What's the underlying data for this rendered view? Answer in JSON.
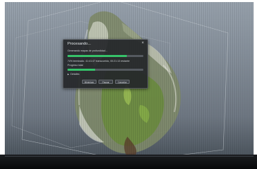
{
  "dialog": {
    "title": "Procesando...",
    "task_label": "Generando mapas de profundidad...",
    "task_progress": 0.78,
    "status_line": "74% terminado. 41:41:47 transcurrido, 00:21:13 restante",
    "total_label": "Progreso total",
    "total_progress": 0.36,
    "details_label": "Detalles",
    "buttons": {
      "minimize": "Minimizar",
      "pause": "Pausar",
      "cancel": "Cancelar"
    }
  },
  "colors": {
    "progress_fill": "#36c36a",
    "dialog_bg": "#242629"
  },
  "icons": {
    "close": "close-icon",
    "details": "chevron-right-icon"
  }
}
